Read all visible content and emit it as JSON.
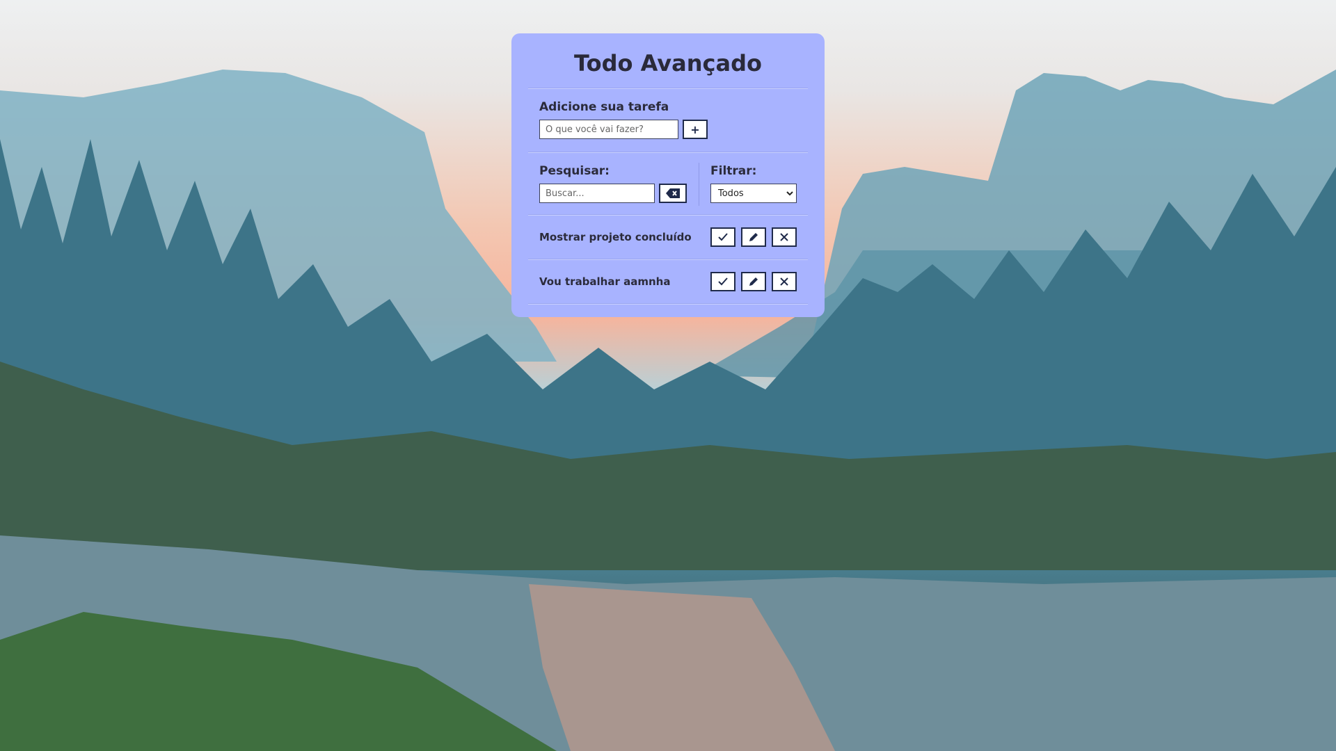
{
  "app": {
    "title": "Todo Avançado"
  },
  "add_task": {
    "label": "Adicione sua tarefa",
    "placeholder": "O que você vai fazer?",
    "add_button": "+"
  },
  "search": {
    "label": "Pesquisar:",
    "placeholder": "Buscar...",
    "clear_icon": "backspace-icon"
  },
  "filter": {
    "label": "Filtrar:",
    "selected": "Todos"
  },
  "todos": [
    {
      "text": "Mostrar projeto concluído"
    },
    {
      "text": "Vou trabalhar aamnha"
    }
  ],
  "icons": {
    "done": "check-icon",
    "edit": "pencil-icon",
    "remove": "close-icon"
  },
  "colors": {
    "card": "#a8b3ff",
    "accent": "#1f2a4a"
  }
}
